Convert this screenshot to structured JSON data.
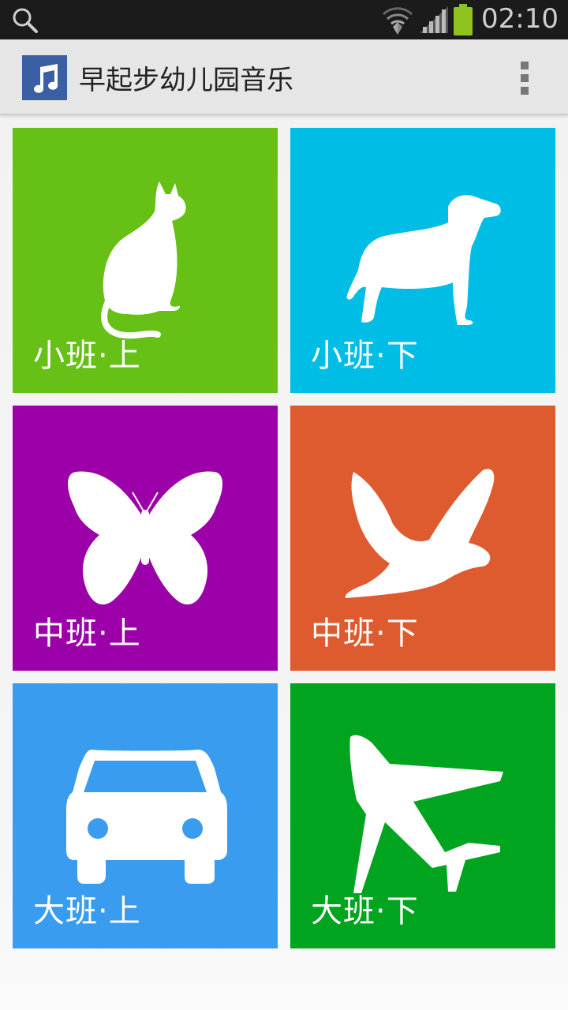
{
  "status_bar": {
    "time": "02:10",
    "icons": [
      "search-icon",
      "wifi-icon",
      "signal-icon",
      "battery-icon"
    ],
    "battery_color": "#8dc21f"
  },
  "action_bar": {
    "title": "早起步幼儿园音乐",
    "app_icon": "music-note-icon",
    "app_icon_color": "#3a5fa3",
    "menu_icon": "overflow-menu-icon"
  },
  "tiles": [
    {
      "label": "小班·上",
      "icon": "cat-icon",
      "color": "#66c015"
    },
    {
      "label": "小班·下",
      "icon": "dog-icon",
      "color": "#00bde6"
    },
    {
      "label": "中班·上",
      "icon": "butterfly-icon",
      "color": "#9c00a8"
    },
    {
      "label": "中班·下",
      "icon": "dove-icon",
      "color": "#de5a2f"
    },
    {
      "label": "大班·上",
      "icon": "car-icon",
      "color": "#3a9cee"
    },
    {
      "label": "大班·下",
      "icon": "airplane-icon",
      "color": "#00a41f"
    }
  ]
}
